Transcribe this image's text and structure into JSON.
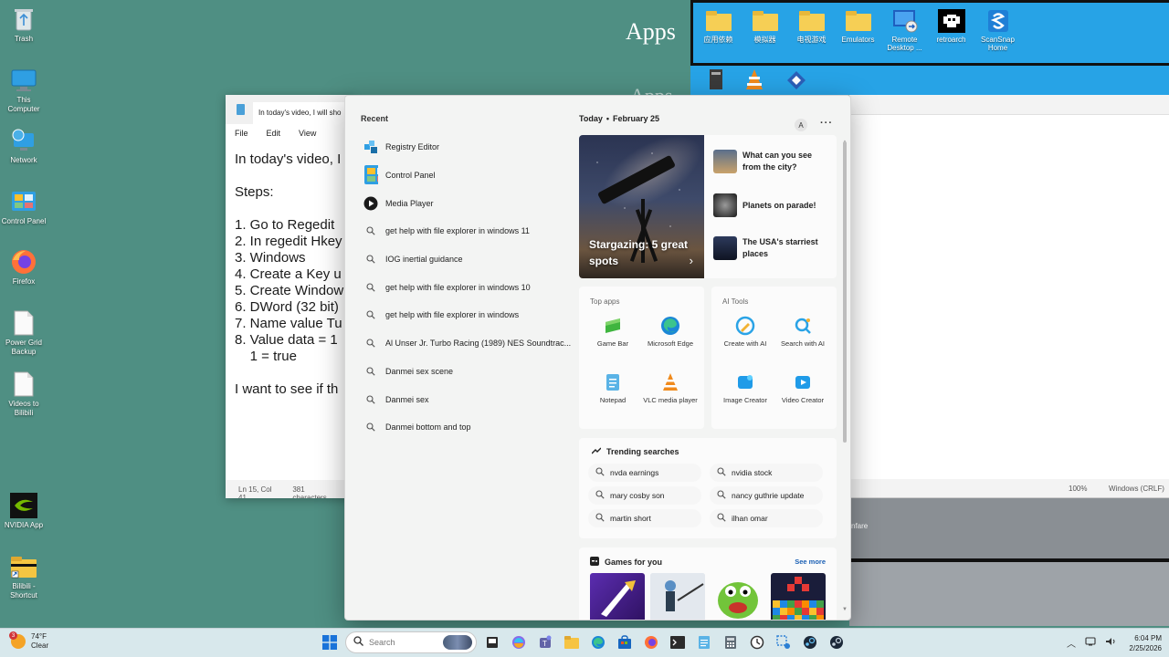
{
  "desktop": {
    "icons": [
      {
        "label": "Trash",
        "icon": "recycle-bin-icon"
      },
      {
        "label": "This Computer",
        "icon": "computer-icon"
      },
      {
        "label": "Network",
        "icon": "network-icon"
      },
      {
        "label": "Control Panel",
        "icon": "control-panel-icon"
      },
      {
        "label": "Firefox",
        "icon": "firefox-icon"
      },
      {
        "label": "Power Grid Backup",
        "icon": "document-icon"
      },
      {
        "label": "Videos to Bilibili",
        "icon": "document-icon"
      },
      {
        "label": "NVIDIA App",
        "icon": "nvidia-icon"
      },
      {
        "label": "Bilibili - Shortcut",
        "icon": "folder-shortcut-icon"
      }
    ]
  },
  "background_window": {
    "heading": "Apps",
    "heading_faded": "Apps",
    "folder_items": [
      {
        "label": "应用依赖",
        "icon": "folder-icon"
      },
      {
        "label": "模拟器",
        "icon": "folder-icon"
      },
      {
        "label": "电视游戏",
        "icon": "folder-icon"
      },
      {
        "label": "Emulators",
        "icon": "folder-icon"
      },
      {
        "label": "Remote Desktop ...",
        "icon": "remote-desktop-icon"
      },
      {
        "label": "retroarch",
        "icon": "retroarch-icon"
      },
      {
        "label": "ScanSnap Home",
        "icon": "scansnap-icon"
      }
    ],
    "status_zoom": "100%",
    "status_encoding": "Windows (CRLF)",
    "partial_label": "nfare"
  },
  "notepad": {
    "tab_title": "In today's video, I will sho",
    "menu": [
      "File",
      "Edit",
      "View"
    ],
    "lines": [
      "In today's video, I",
      "",
      "Steps:",
      "",
      "1. Go to Regedit",
      "2. In regedit Hkey",
      "3. Windows",
      "4. Create a Key u",
      "5. Create Window",
      "6. DWord (32 bit)",
      "7. Name value Tu",
      "8. Value data = 1",
      "    1 = true",
      "",
      "I want to see if th"
    ],
    "status_position": "Ln 15, Col 41",
    "status_chars": "381 characters"
  },
  "start_menu": {
    "recent_heading": "Recent",
    "recent": [
      {
        "label": "Registry Editor",
        "icon": "registry-editor-icon"
      },
      {
        "label": "Control Panel",
        "icon": "control-panel-icon"
      },
      {
        "label": "Media Player",
        "icon": "media-player-icon"
      },
      {
        "label": "get help with file explorer in windows 11",
        "icon": "search-icon"
      },
      {
        "label": "IOG inertial guidance",
        "icon": "search-icon"
      },
      {
        "label": "get help with file explorer in windows 10",
        "icon": "search-icon"
      },
      {
        "label": "get help with file explorer in windows",
        "icon": "search-icon"
      },
      {
        "label": "Al Unser Jr. Turbo Racing (1989) NES Soundtrac...",
        "icon": "search-icon"
      },
      {
        "label": "Danmei sex scene",
        "icon": "search-icon"
      },
      {
        "label": "Danmei sex",
        "icon": "search-icon"
      },
      {
        "label": "Danmei bottom and top",
        "icon": "search-icon"
      }
    ],
    "today_label": "Today",
    "date_label": "February 25",
    "avatar_letter": "A",
    "more_label": "···",
    "hero_caption": "Stargazing: 5 great spots",
    "hero_arrow": "›",
    "stories": [
      {
        "title": "What can you see from the city?"
      },
      {
        "title": "Planets on parade!"
      },
      {
        "title": "The USA's starriest places"
      }
    ],
    "top_apps_heading": "Top apps",
    "top_apps": [
      {
        "label": "Game Bar",
        "icon": "game-bar-icon"
      },
      {
        "label": "Microsoft Edge",
        "icon": "edge-icon"
      },
      {
        "label": "Notepad",
        "icon": "notepad-icon"
      },
      {
        "label": "VLC media player",
        "icon": "vlc-icon"
      }
    ],
    "ai_tools_heading": "AI Tools",
    "ai_tools": [
      {
        "label": "Create with AI",
        "icon": "create-ai-icon"
      },
      {
        "label": "Search with AI",
        "icon": "search-ai-icon"
      },
      {
        "label": "Image Creator",
        "icon": "image-creator-icon"
      },
      {
        "label": "Video Creator",
        "icon": "video-creator-icon"
      }
    ],
    "trending_heading": "Trending searches",
    "trending": [
      "nvda earnings",
      "nvidia stock",
      "mary cosby son",
      "nancy guthrie update",
      "martin short",
      "ilhan omar"
    ],
    "games_heading": "Games for you",
    "see_more": "See more"
  },
  "taskbar": {
    "weather_temp": "74°F",
    "weather_cond": "Clear",
    "weather_badge": "3",
    "search_placeholder": "Search",
    "clock_time": "6:04 PM",
    "clock_date": "2/25/2026"
  }
}
